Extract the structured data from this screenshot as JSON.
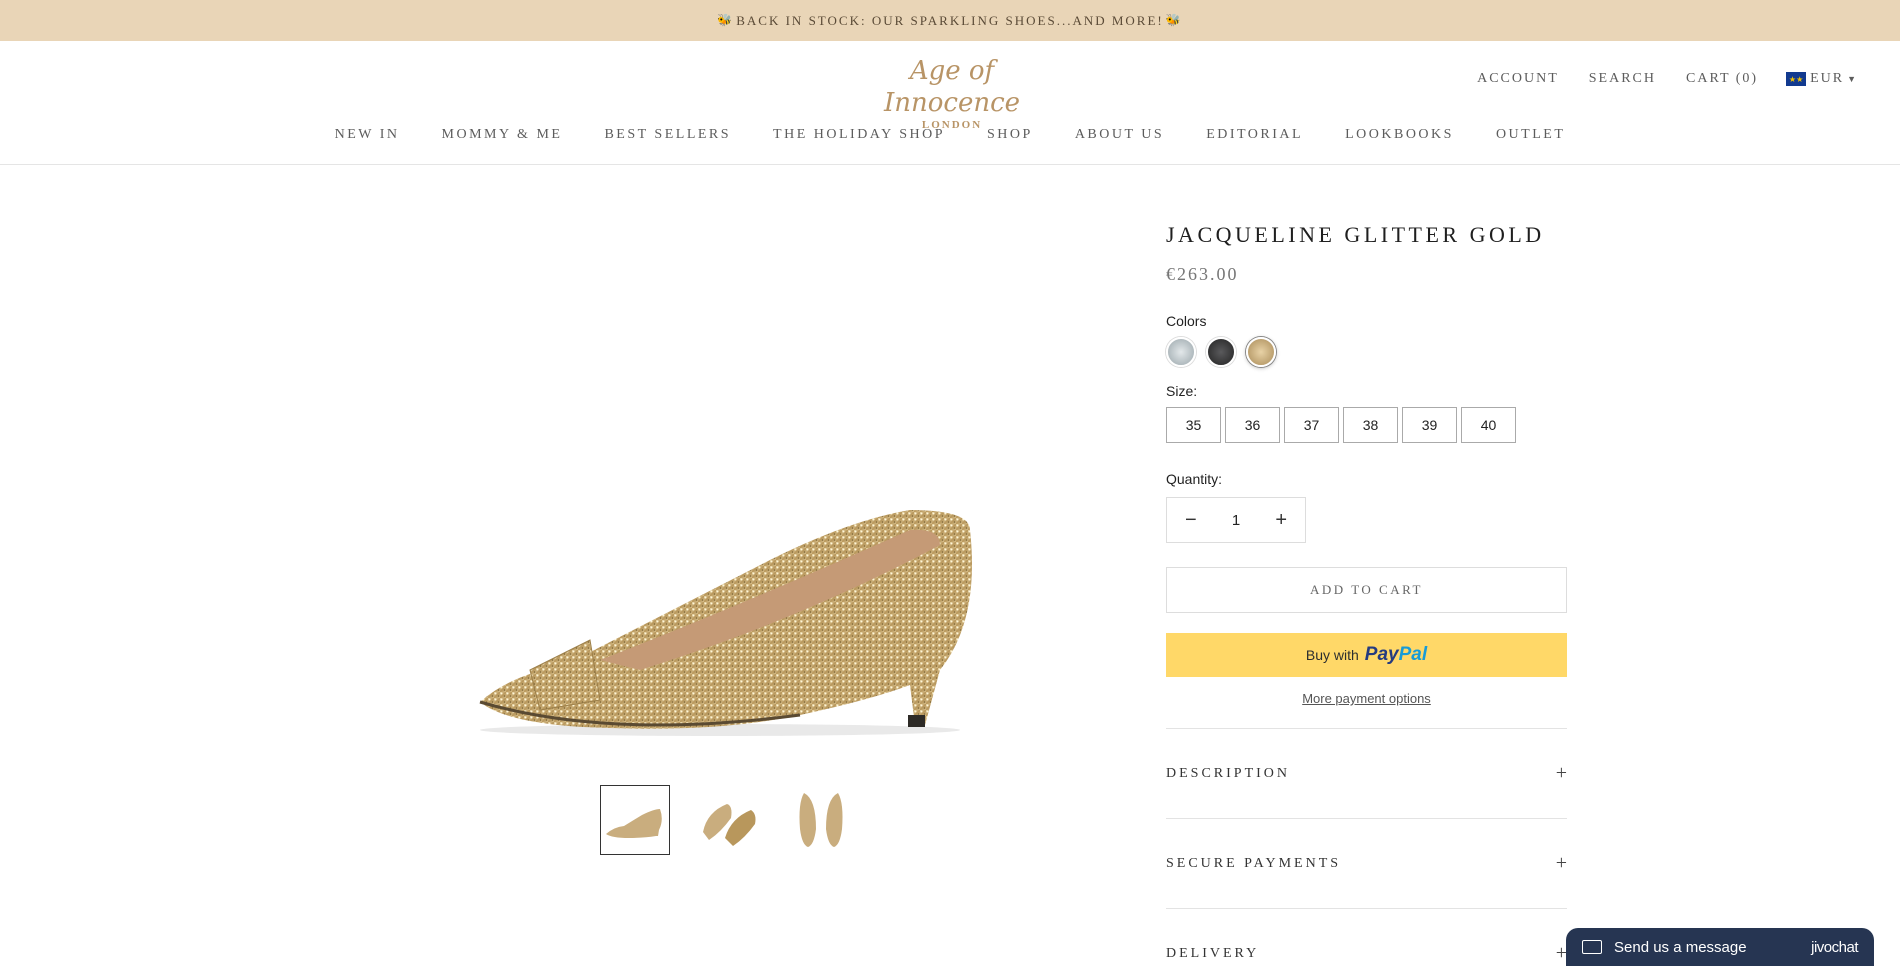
{
  "announcement": {
    "text": "BACK IN STOCK: OUR SPARKLING SHOES...AND MORE!"
  },
  "brand": {
    "logo_script": "Age of Innocence",
    "logo_city": "LONDON"
  },
  "header": {
    "account": "ACCOUNT",
    "search": "SEARCH",
    "cart": "CART (0)",
    "currency": "EUR"
  },
  "nav": {
    "items": [
      "NEW IN",
      "MOMMY & ME",
      "BEST SELLERS",
      "THE HOLIDAY SHOP",
      "SHOP",
      "ABOUT US",
      "EDITORIAL",
      "LOOKBOOKS",
      "OUTLET"
    ]
  },
  "product": {
    "title": "JACQUELINE GLITTER GOLD",
    "price": "€263.00",
    "colors_label": "Colors",
    "colors": [
      {
        "name": "silver",
        "hex": "#b9c3c8"
      },
      {
        "name": "black",
        "hex": "#3b3b3d"
      },
      {
        "name": "gold",
        "hex": "#c9ad7e",
        "selected": true
      }
    ],
    "size_label": "Size:",
    "sizes": [
      "35",
      "36",
      "37",
      "38",
      "39",
      "40"
    ],
    "quantity_label": "Quantity:",
    "quantity": "1",
    "add_to_cart": "ADD TO CART",
    "paypal": {
      "buy_with": "Buy with",
      "pay": "Pay",
      "pal": "Pal"
    },
    "more_payment": "More payment options",
    "accordion": [
      "DESCRIPTION",
      "SECURE PAYMENTS",
      "DELIVERY"
    ]
  },
  "chat": {
    "message": "Send us a message",
    "brand": "jivochat"
  },
  "colors": {
    "announcement_bg": "#e9d5b7",
    "logo_gold": "#b89466",
    "paypal_yellow": "#ffd868",
    "chat_bg": "#263552"
  }
}
